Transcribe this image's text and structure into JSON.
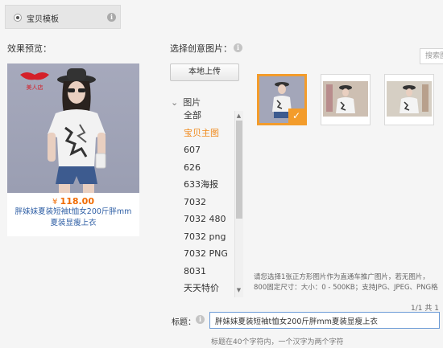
{
  "template": {
    "label": "宝贝模板"
  },
  "preview": {
    "section_label": "效果预览：",
    "price_symbol": "¥",
    "price": "118.00",
    "title": "胖妹妹夏装短袖t恤女200斤胖mm夏装显瘦上衣",
    "logo_text": "美人店"
  },
  "picker": {
    "section_label": "选择创意图片：",
    "upload_label": "本地上传",
    "search_placeholder": "搜索图",
    "tree_head": "图片",
    "folders": [
      "全部",
      "宝贝主图",
      "607",
      "626",
      "633海报",
      "7032",
      "7032 480",
      "7032 png",
      "7032 PNG",
      "8031",
      "天天特价"
    ],
    "active_folder": "宝贝主图",
    "hint_line1": "请您选择1张正方形图片作为直通车推广图片，若无图片，",
    "hint_line2": "800固定尺寸：大小：0 - 500KB；支持JPG、JPEG、PNG格",
    "pager": "1/1   共 1"
  },
  "title_field": {
    "label": "标题：",
    "value": "胖妹妹夏装短袖t恤女200斤胖mm夏装显瘦上衣",
    "note": "标题在40个字符内，一个汉字为两个字符"
  },
  "colors": {
    "accent": "#f39c2b",
    "link": "#2f5fa5",
    "price": "#f06a00"
  }
}
